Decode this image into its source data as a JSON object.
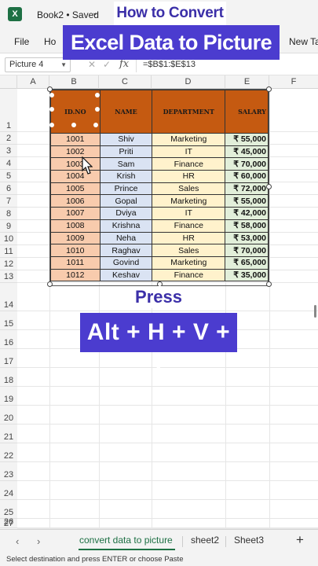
{
  "app": {
    "logo_letter": "X",
    "book_title": "Book2 • Saved",
    "brand_color": "#1d7044"
  },
  "ribbon": {
    "tabs": [
      "File",
      "Ho",
      "New Ta"
    ]
  },
  "formula_bar": {
    "name_box": "Picture 4",
    "formula": "=$B$1:$E$13",
    "fx": "fx"
  },
  "columns": [
    "A",
    "B",
    "C",
    "D",
    "E",
    "F"
  ],
  "rows": [
    "1",
    "2",
    "3",
    "4",
    "5",
    "6",
    "7",
    "8",
    "9",
    "10",
    "11",
    "12",
    "13",
    "14",
    "15",
    "16",
    "17",
    "18",
    "19",
    "20",
    "21",
    "22",
    "23",
    "24",
    "25",
    "26",
    "27"
  ],
  "table": {
    "headers": [
      "ID.NO",
      "NAME",
      "DEPARTMENT",
      "SALARY"
    ],
    "rows": [
      [
        "1001",
        "Shiv",
        "Marketing",
        "₹ 55,000"
      ],
      [
        "1002",
        "Priti",
        "IT",
        "₹ 45,000"
      ],
      [
        "1003",
        "Sam",
        "Finance",
        "₹ 70,000"
      ],
      [
        "1004",
        "Krish",
        "HR",
        "₹ 60,000"
      ],
      [
        "1005",
        "Prince",
        "Sales",
        "₹ 72,000"
      ],
      [
        "1006",
        "Gopal",
        "Marketing",
        "₹ 55,000"
      ],
      [
        "1007",
        "Dviya",
        "IT",
        "₹ 42,000"
      ],
      [
        "1008",
        "Krishna",
        "Finance",
        "₹ 58,000"
      ],
      [
        "1009",
        "Neha",
        "HR",
        "₹ 53,000"
      ],
      [
        "1010",
        "Raghav",
        "Sales",
        "₹ 70,000"
      ],
      [
        "1011",
        "Govind",
        "Marketing",
        "₹ 65,000"
      ],
      [
        "1012",
        "Keshav",
        "Finance",
        "₹ 35,000"
      ]
    ],
    "colors": {
      "header": "#c55a11",
      "id": "#f8cbad",
      "name": "#dae3f3",
      "department": "#fff2cc",
      "salary": "#e2efda"
    }
  },
  "overlays": {
    "top": "How to Convert",
    "main": "Excel Data to Picture",
    "press": "Press",
    "keys": "Alt + H + V + I",
    "accent": "#4b3ccf"
  },
  "sheets": {
    "tabs": [
      "convert data to picture",
      "sheet2",
      "Sheet3"
    ],
    "active": "convert data to picture",
    "add": "+"
  },
  "status": {
    "message": "Select destination and press ENTER or choose Paste"
  }
}
